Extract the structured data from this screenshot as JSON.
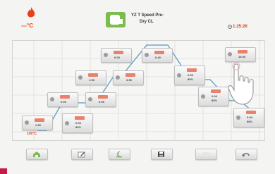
{
  "header": {
    "current_temp": "---°C",
    "program_name_line1": "YZ T Speed Pre-",
    "program_name_line2": "Dry CL",
    "remaining_time": "1:25:26"
  },
  "graph": {
    "start_temp": "100°C",
    "params": [
      {
        "id": "p1",
        "v1": "1:50"
      },
      {
        "id": "p2",
        "v1": "0:00"
      },
      {
        "id": "p3",
        "v1": "1:50"
      },
      {
        "id": "p4",
        "v1": "0:00"
      },
      {
        "id": "p5",
        "v1": "0:00"
      },
      {
        "id": "p6",
        "v1": "3:50"
      },
      {
        "id": "p7",
        "v1": "0:40"
      },
      {
        "id": "p8",
        "v1": "18:00"
      },
      {
        "id": "p9",
        "v1": "0:00",
        "v2": "80%"
      },
      {
        "id": "p10",
        "v1": "0:00",
        "v2": "80%"
      },
      {
        "id": "p11",
        "v1": "0:00",
        "v2": "80%"
      },
      {
        "id": "p12",
        "v1": "0:00",
        "v2": "80%"
      },
      {
        "id": "p13",
        "v1": "0:00",
        "v2": "80%"
      }
    ]
  },
  "toolbar": {
    "buttons": [
      {
        "name": "home-button",
        "icon": "home-icon"
      },
      {
        "name": "edit-button",
        "icon": "edit-icon"
      },
      {
        "name": "night-mode-button",
        "icon": "moon-icon"
      },
      {
        "name": "save-button",
        "icon": "save-icon"
      },
      {
        "name": "dim-button",
        "icon": "blank-icon"
      },
      {
        "name": "back-button",
        "icon": "return-icon"
      }
    ]
  },
  "colors": {
    "accent_red": "#e8411a",
    "program_green": "#7bbd4c",
    "curve_blue": "#6ea7c4"
  }
}
